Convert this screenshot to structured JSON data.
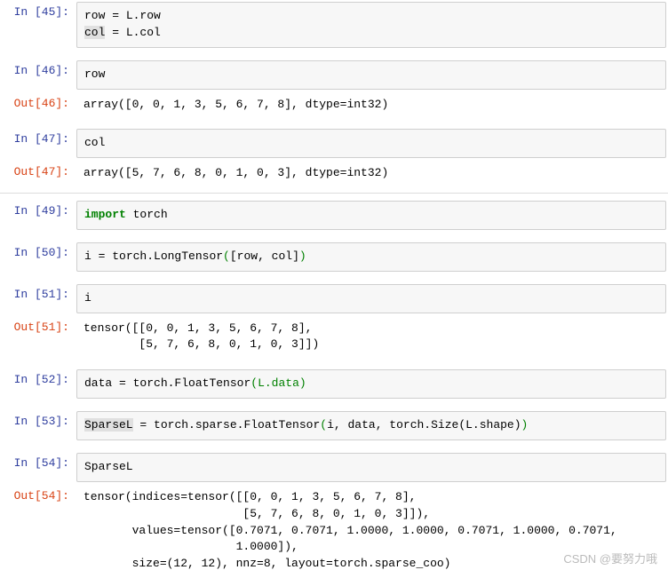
{
  "cells": {
    "c45": {
      "prompt": "In [45]:",
      "line1a": "row ",
      "line1b": "=",
      "line1c": " L.row",
      "line2a": "col",
      "line2b": " ",
      "line2c": "=",
      "line2d": " L.col"
    },
    "c46": {
      "prompt": "In [46]:",
      "code": "row"
    },
    "o46": {
      "prompt": "Out[46]:",
      "text": "array([0, 0, 1, 3, 5, 6, 7, 8], dtype=int32)"
    },
    "c47": {
      "prompt": "In [47]:",
      "code": "col"
    },
    "o47": {
      "prompt": "Out[47]:",
      "text": "array([5, 7, 6, 8, 0, 1, 0, 3], dtype=int32)"
    },
    "c49": {
      "prompt": "In [49]:",
      "kw": "import",
      "rest": " torch"
    },
    "c50": {
      "prompt": "In [50]:",
      "a": "i ",
      "b": "=",
      "c": " torch.LongTensor",
      "d": "(",
      "e": "[row, col]",
      "f": ")"
    },
    "c51": {
      "prompt": "In [51]:",
      "code": "i"
    },
    "o51": {
      "prompt": "Out[51]:",
      "line1": "tensor([[0, 0, 1, 3, 5, 6, 7, 8],",
      "line2": "        [5, 7, 6, 8, 0, 1, 0, 3]])"
    },
    "c52": {
      "prompt": "In [52]:",
      "a": "data ",
      "b": "=",
      "c": " torch.FloatTensor",
      "d": "(",
      "e": "L.data",
      "f": ")"
    },
    "c53": {
      "prompt": "In [53]:",
      "a": "SparseL",
      "sp": " ",
      "b": "=",
      "c": " torch.sparse.FloatTensor",
      "d": "(",
      "e": "i, data, torch.Size(L.shape)",
      "f": ")"
    },
    "c54": {
      "prompt": "In [54]:",
      "code": "SparseL"
    },
    "o54": {
      "prompt": "Out[54]:",
      "line1": "tensor(indices=tensor([[0, 0, 1, 3, 5, 6, 7, 8],",
      "line2": "                       [5, 7, 6, 8, 0, 1, 0, 3]]),",
      "line3": "       values=tensor([0.7071, 0.7071, 1.0000, 1.0000, 0.7071, 1.0000, 0.7071,",
      "line4": "                      1.0000]),",
      "line5": "       size=(12, 12), nnz=8, layout=torch.sparse_coo)"
    }
  },
  "watermark": "CSDN @要努力哦"
}
